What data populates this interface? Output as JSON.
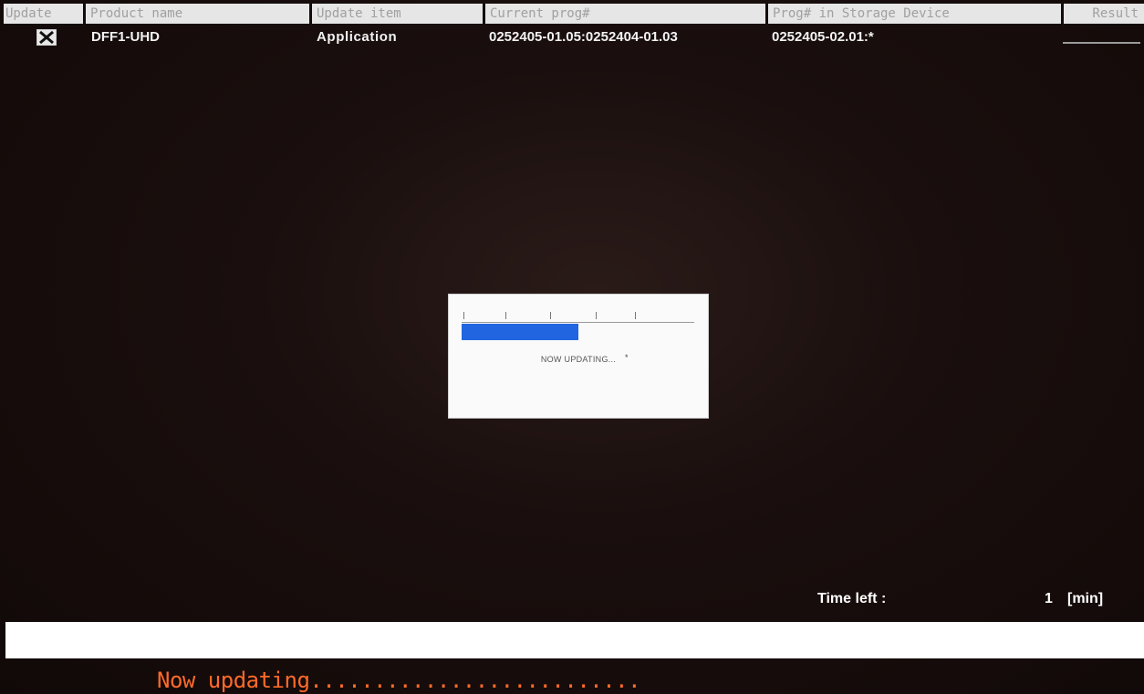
{
  "header": {
    "update": "Update",
    "product_name": "Product name",
    "update_item": "Update item",
    "current_prog": "Current prog#",
    "prog_in_storage": "Prog# in Storage Device",
    "result": "Result"
  },
  "row": {
    "checked": true,
    "product_name": "DFF1-UHD",
    "update_item": "Application",
    "current_prog": "0252405-01.05:0252404-01.03",
    "prog_in_storage": "0252405-02.01:*",
    "result": ""
  },
  "dialog": {
    "message": "NOW UPDATING...",
    "marker": "*",
    "progress_fraction": 0.5
  },
  "time_left": {
    "label": "Time left :",
    "value": "1",
    "unit": "[min]"
  },
  "status": {
    "text": "Now updating.........................."
  },
  "colors": {
    "status_text": "#ff6a2a",
    "progress_fill": "#2166e0",
    "header_bg": "#e6e6e6"
  },
  "icons": {
    "checkbox": "checkbox-checked-icon"
  }
}
